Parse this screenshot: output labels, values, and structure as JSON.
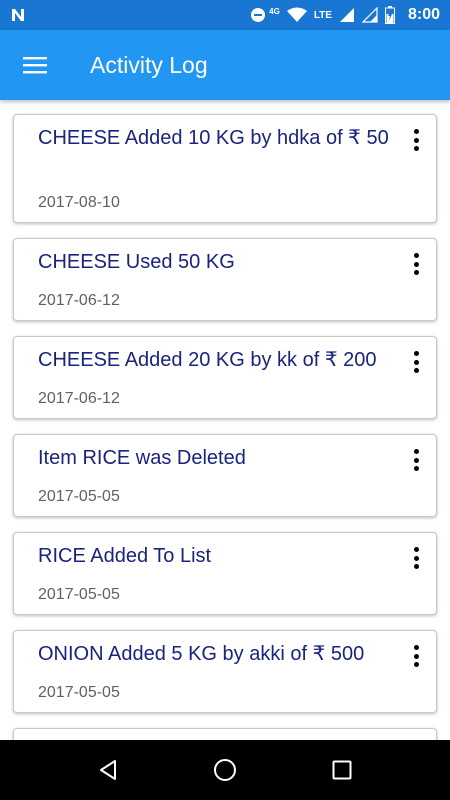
{
  "status_bar": {
    "time": "8:00",
    "network_label": "4G",
    "lte_label": "LTE",
    "icons": [
      "notification-n-icon",
      "do-not-disturb-icon",
      "wifi-icon",
      "signal-icon",
      "battery-charging-icon"
    ]
  },
  "app_bar": {
    "title": "Activity Log",
    "menu_icon": "hamburger-menu-icon",
    "color": "#2196f3"
  },
  "activity_items": [
    {
      "title": "CHEESE Added 10 KG by hdka of ₹ 50",
      "date": "2017-08-10"
    },
    {
      "title": "CHEESE Used 50 KG",
      "date": "2017-06-12"
    },
    {
      "title": "CHEESE Added 20 KG by kk of ₹ 200",
      "date": "2017-06-12"
    },
    {
      "title": "Item RICE was Deleted",
      "date": "2017-05-05"
    },
    {
      "title": "RICE Added To List",
      "date": "2017-05-05"
    },
    {
      "title": "ONION Added 5 KG by akki of ₹ 500",
      "date": "2017-05-05"
    }
  ],
  "nav_bar": {
    "icons": [
      "back-icon",
      "home-icon",
      "recents-icon"
    ]
  },
  "colors": {
    "title_text": "#1a237e",
    "date_text": "#616161",
    "status_bar": "#1976d2"
  }
}
